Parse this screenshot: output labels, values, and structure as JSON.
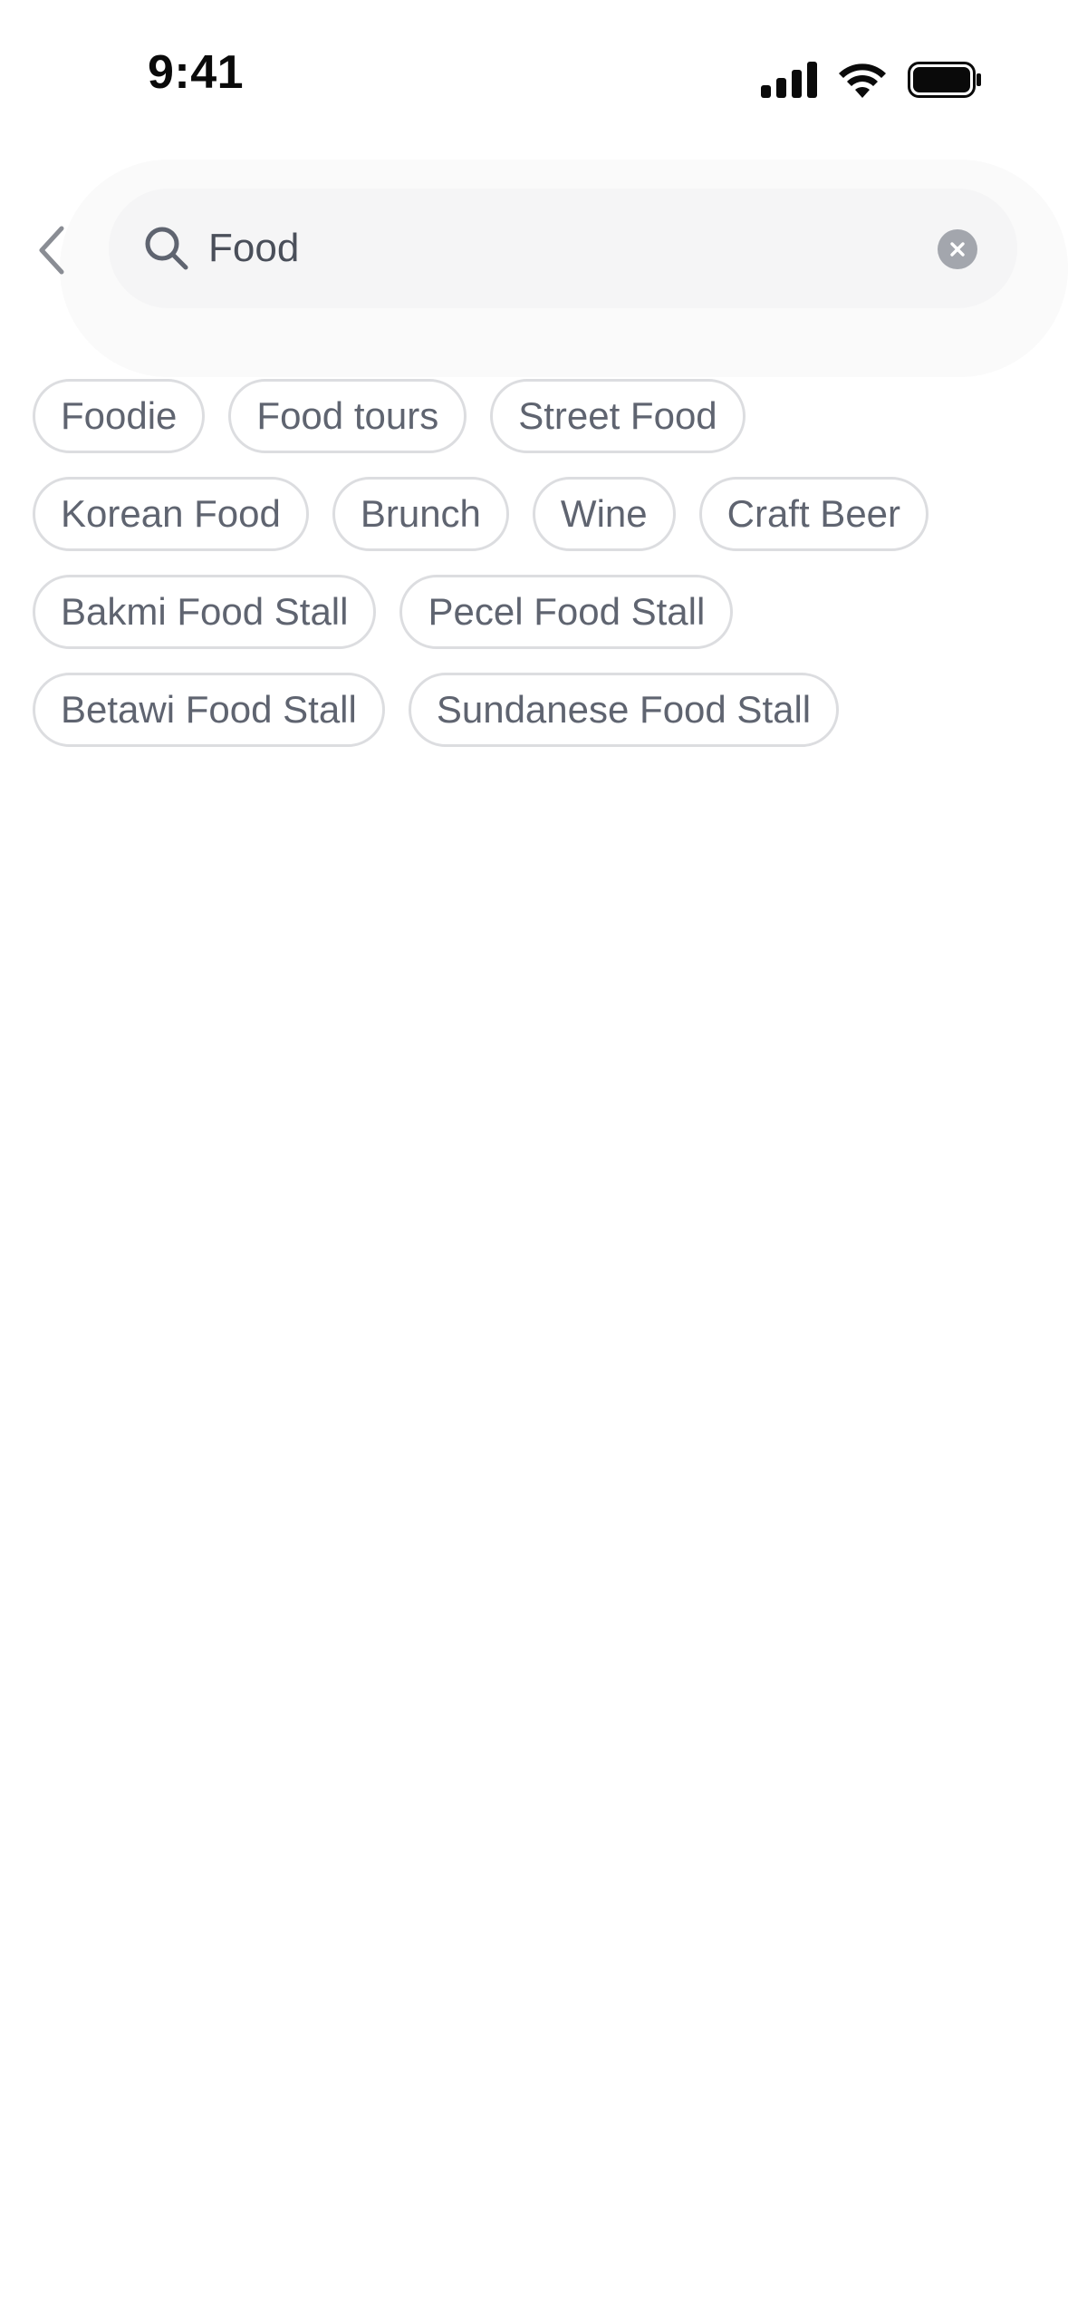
{
  "status_bar": {
    "time": "9:41",
    "icons": [
      "cellular-signal-icon",
      "wifi-icon",
      "battery-icon"
    ]
  },
  "search": {
    "value": "Food",
    "icons": [
      "chevron-left-icon",
      "search-icon",
      "clear-icon"
    ]
  },
  "chips": {
    "rows": [
      [
        "Foodie",
        "Food tours",
        "Street Food"
      ],
      [
        "Korean Food",
        "Brunch",
        "Wine",
        "Craft Beer"
      ],
      [
        "Bakmi Food Stall",
        "Pecel Food Stall"
      ],
      [
        "Betawi Food Stall",
        "Sundanese Food Stall"
      ]
    ]
  },
  "colors": {
    "chip_text": "#5f6470",
    "chip_border": "#dcdde0",
    "search_bg": "#f5f5f6",
    "clear_icon_bg": "#a3a6ad"
  }
}
